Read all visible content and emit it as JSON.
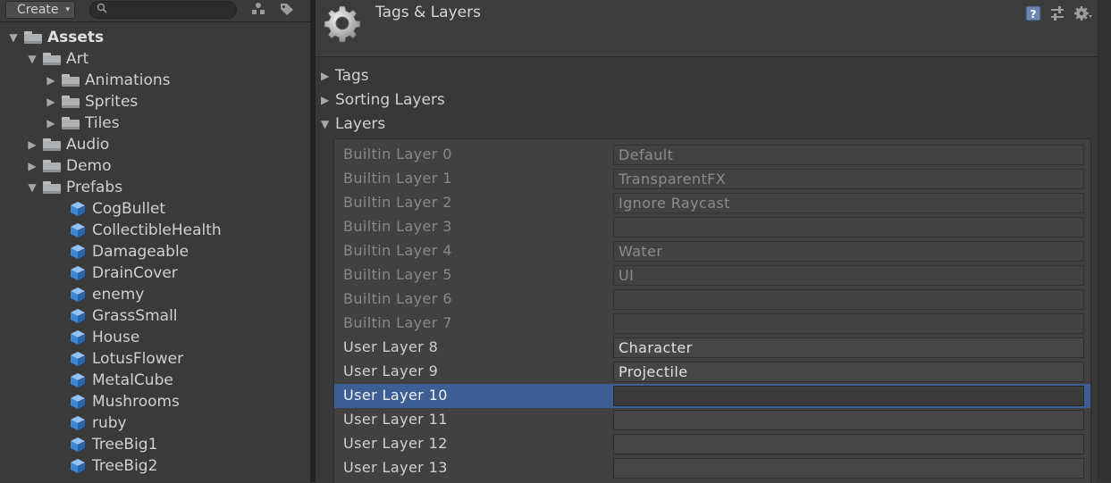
{
  "project_panel": {
    "toolbar": {
      "create_label": "Create",
      "create_arrow": "▾",
      "search_placeholder": "",
      "icons": [
        "search-icon",
        "scene-filter-icon",
        "label-filter-icon"
      ]
    },
    "tree": [
      {
        "label": "Assets",
        "depth": 0,
        "type": "folder",
        "expanded": true
      },
      {
        "label": "Art",
        "depth": 1,
        "type": "folder",
        "expanded": true
      },
      {
        "label": "Animations",
        "depth": 2,
        "type": "folder",
        "expanded": false
      },
      {
        "label": "Sprites",
        "depth": 2,
        "type": "folder",
        "expanded": false
      },
      {
        "label": "Tiles",
        "depth": 2,
        "type": "folder",
        "expanded": false
      },
      {
        "label": "Audio",
        "depth": 1,
        "type": "folder",
        "expanded": false
      },
      {
        "label": "Demo",
        "depth": 1,
        "type": "folder",
        "expanded": false
      },
      {
        "label": "Prefabs",
        "depth": 1,
        "type": "folder",
        "expanded": true
      },
      {
        "label": "CogBullet",
        "depth": 2,
        "type": "prefab"
      },
      {
        "label": "CollectibleHealth",
        "depth": 2,
        "type": "prefab"
      },
      {
        "label": "Damageable",
        "depth": 2,
        "type": "prefab"
      },
      {
        "label": "DrainCover",
        "depth": 2,
        "type": "prefab"
      },
      {
        "label": "enemy",
        "depth": 2,
        "type": "prefab"
      },
      {
        "label": "GrassSmall",
        "depth": 2,
        "type": "prefab"
      },
      {
        "label": "House",
        "depth": 2,
        "type": "prefab"
      },
      {
        "label": "LotusFlower",
        "depth": 2,
        "type": "prefab"
      },
      {
        "label": "MetalCube",
        "depth": 2,
        "type": "prefab"
      },
      {
        "label": "Mushrooms",
        "depth": 2,
        "type": "prefab"
      },
      {
        "label": "ruby",
        "depth": 2,
        "type": "prefab"
      },
      {
        "label": "TreeBig1",
        "depth": 2,
        "type": "prefab"
      },
      {
        "label": "TreeBig2",
        "depth": 2,
        "type": "prefab"
      }
    ]
  },
  "inspector": {
    "title": "Tags & Layers",
    "header_icons": [
      "help-icon",
      "preset-icon",
      "settings-gear-icon"
    ],
    "sections": [
      {
        "label": "Tags",
        "expanded": false
      },
      {
        "label": "Sorting Layers",
        "expanded": false
      },
      {
        "label": "Layers",
        "expanded": true
      }
    ],
    "layers": [
      {
        "name": "Builtin Layer 0",
        "value": "Default",
        "builtin": true
      },
      {
        "name": "Builtin Layer 1",
        "value": "TransparentFX",
        "builtin": true
      },
      {
        "name": "Builtin Layer 2",
        "value": "Ignore Raycast",
        "builtin": true
      },
      {
        "name": "Builtin Layer 3",
        "value": "",
        "builtin": true
      },
      {
        "name": "Builtin Layer 4",
        "value": "Water",
        "builtin": true
      },
      {
        "name": "Builtin Layer 5",
        "value": "UI",
        "builtin": true
      },
      {
        "name": "Builtin Layer 6",
        "value": "",
        "builtin": true
      },
      {
        "name": "Builtin Layer 7",
        "value": "",
        "builtin": true
      },
      {
        "name": "User Layer 8",
        "value": "Character",
        "builtin": false
      },
      {
        "name": "User Layer 9",
        "value": "Projectile",
        "builtin": false
      },
      {
        "name": "User Layer 10",
        "value": "",
        "builtin": false,
        "selected": true
      },
      {
        "name": "User Layer 11",
        "value": "",
        "builtin": false
      },
      {
        "name": "User Layer 12",
        "value": "",
        "builtin": false
      },
      {
        "name": "User Layer 13",
        "value": "",
        "builtin": false
      }
    ]
  },
  "colors": {
    "selection": "#3e5f96",
    "panel_bg": "#383838",
    "text": "#d0d0d0",
    "disabled_text": "#888888",
    "prefab_blue": "#4a90d9"
  }
}
